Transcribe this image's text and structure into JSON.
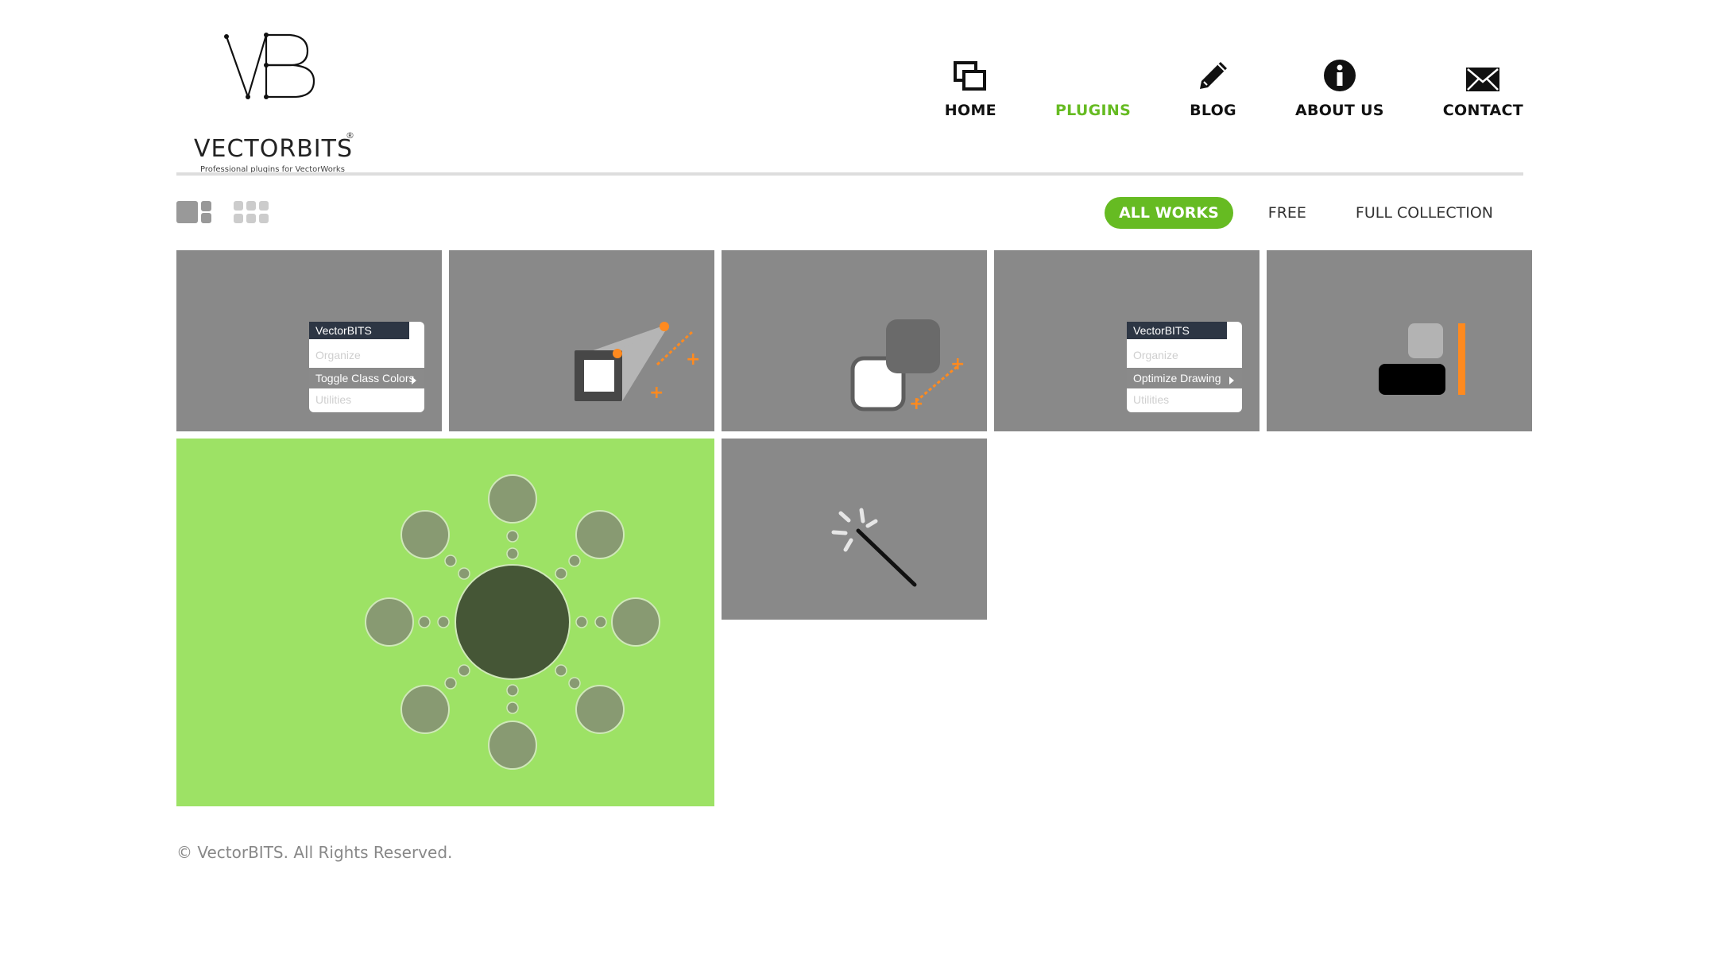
{
  "brand": {
    "name": "VECTORBITS",
    "registered": "®",
    "tagline": "Professional plugins for VectorWorks"
  },
  "nav": [
    {
      "label": "HOME",
      "icon": "windows-icon"
    },
    {
      "label": "PLUGINS",
      "icon": "bars-icon",
      "active": true
    },
    {
      "label": "BLOG",
      "icon": "pencil-icon"
    },
    {
      "label": "ABOUT US",
      "icon": "info-icon"
    },
    {
      "label": "CONTACT",
      "icon": "envelope-icon"
    }
  ],
  "filters": [
    {
      "label": "ALL WORKS",
      "active": true
    },
    {
      "label": "FREE"
    },
    {
      "label": "FULL COLLECTION"
    }
  ],
  "tiles": {
    "t1": {
      "menu_title": "VectorBITS",
      "items": [
        "Organize",
        "Toggle Class Colors",
        "Utilities"
      ]
    },
    "t4": {
      "menu_title": "VectorBITS",
      "items": [
        "Organize",
        "Optimize Drawing",
        "Utilities"
      ]
    }
  },
  "footer": {
    "copyright": "© VectorBITS. All Rights Reserved."
  },
  "colors": {
    "accent": "#66bb22",
    "tile": "#898989",
    "featured": "#9de265",
    "orange": "#ff8a1f"
  }
}
